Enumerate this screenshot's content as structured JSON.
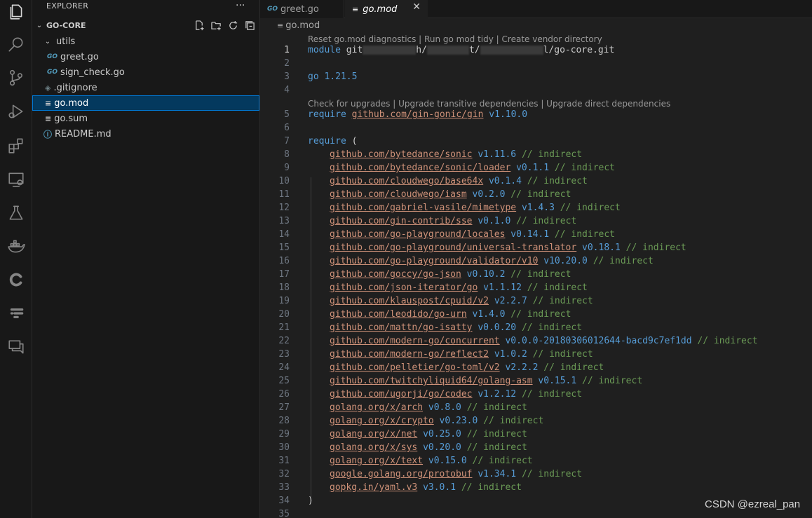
{
  "sidebar": {
    "title": "EXPLORER",
    "more": "···",
    "workspace": "GO-CORE",
    "items": [
      {
        "label": "utils",
        "kind": "folder"
      },
      {
        "label": "greet.go",
        "kind": "go"
      },
      {
        "label": "sign_check.go",
        "kind": "go"
      },
      {
        "label": ".gitignore",
        "kind": "git"
      },
      {
        "label": "go.mod",
        "kind": "mod"
      },
      {
        "label": "go.sum",
        "kind": "mod"
      },
      {
        "label": "README.md",
        "kind": "info"
      }
    ]
  },
  "tabs": [
    {
      "label": "greet.go",
      "active": false
    },
    {
      "label": "go.mod",
      "active": true,
      "close": "✕"
    }
  ],
  "breadcrumb": "go.mod",
  "lenses": {
    "top": "Reset go.mod diagnostics | Run go mod tidy | Create vendor directory",
    "require": "Check for upgrades | Upgrade transitive dependencies | Upgrade direct dependencies"
  },
  "code": {
    "module_kw": "module",
    "module_path_a": "git",
    "module_path_b": "h/",
    "module_path_c": "t/",
    "module_path_d": "l/go-core.git",
    "go_kw": "go",
    "go_version": "1.21.5",
    "require_kw": "require",
    "direct_dep": "github.com/gin-gonic/gin",
    "direct_ver": "v1.10.0",
    "open_paren": "(",
    "close_paren": ")",
    "indirect": "// indirect",
    "deps": [
      {
        "path": "github.com/bytedance/sonic",
        "ver": "v1.11.6"
      },
      {
        "path": "github.com/bytedance/sonic/loader",
        "ver": "v0.1.1"
      },
      {
        "path": "github.com/cloudwego/base64x",
        "ver": "v0.1.4"
      },
      {
        "path": "github.com/cloudwego/iasm",
        "ver": "v0.2.0"
      },
      {
        "path": "github.com/gabriel-vasile/mimetype",
        "ver": "v1.4.3"
      },
      {
        "path": "github.com/gin-contrib/sse",
        "ver": "v0.1.0"
      },
      {
        "path": "github.com/go-playground/locales",
        "ver": "v0.14.1"
      },
      {
        "path": "github.com/go-playground/universal-translator",
        "ver": "v0.18.1"
      },
      {
        "path": "github.com/go-playground/validator/v10",
        "ver": "v10.20.0"
      },
      {
        "path": "github.com/goccy/go-json",
        "ver": "v0.10.2"
      },
      {
        "path": "github.com/json-iterator/go",
        "ver": "v1.1.12"
      },
      {
        "path": "github.com/klauspost/cpuid/v2",
        "ver": "v2.2.7"
      },
      {
        "path": "github.com/leodido/go-urn",
        "ver": "v1.4.0"
      },
      {
        "path": "github.com/mattn/go-isatty",
        "ver": "v0.0.20"
      },
      {
        "path": "github.com/modern-go/concurrent",
        "ver": "v0.0.0-20180306012644-bacd9c7ef1dd"
      },
      {
        "path": "github.com/modern-go/reflect2",
        "ver": "v1.0.2"
      },
      {
        "path": "github.com/pelletier/go-toml/v2",
        "ver": "v2.2.2"
      },
      {
        "path": "github.com/twitchyliquid64/golang-asm",
        "ver": "v0.15.1"
      },
      {
        "path": "github.com/ugorji/go/codec",
        "ver": "v1.2.12"
      },
      {
        "path": "golang.org/x/arch",
        "ver": "v0.8.0"
      },
      {
        "path": "golang.org/x/crypto",
        "ver": "v0.23.0"
      },
      {
        "path": "golang.org/x/net",
        "ver": "v0.25.0"
      },
      {
        "path": "golang.org/x/sys",
        "ver": "v0.20.0"
      },
      {
        "path": "golang.org/x/text",
        "ver": "v0.15.0"
      },
      {
        "path": "google.golang.org/protobuf",
        "ver": "v1.34.1"
      },
      {
        "path": "gopkg.in/yaml.v3",
        "ver": "v3.0.1"
      }
    ],
    "line_numbers": [
      "1",
      "2",
      "3",
      "4",
      "5",
      "6",
      "7",
      "8",
      "9",
      "10",
      "11",
      "12",
      "13",
      "14",
      "15",
      "16",
      "17",
      "18",
      "19",
      "20",
      "21",
      "22",
      "23",
      "24",
      "25",
      "26",
      "27",
      "28",
      "29",
      "30",
      "31",
      "32",
      "33",
      "34",
      "35"
    ]
  },
  "watermark": "CSDN @ezreal_pan",
  "colors": {
    "accent": "#0078d4",
    "keyword": "#569cd6",
    "string": "#ce9178",
    "comment": "#6a9955"
  }
}
